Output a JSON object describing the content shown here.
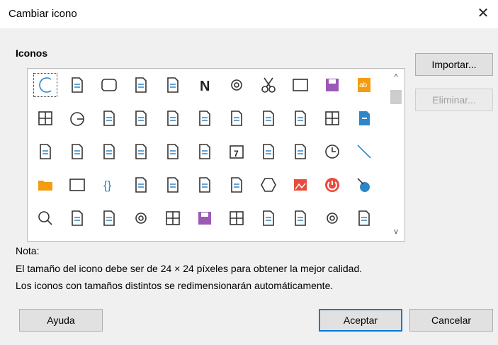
{
  "dialog": {
    "title": "Cambiar icono",
    "close_glyph": "✕"
  },
  "icons_label": "Iconos",
  "buttons": {
    "import": "Importar...",
    "delete": "Eliminar...",
    "help": "Ayuda",
    "accept": "Aceptar",
    "cancel": "Cancelar"
  },
  "note": {
    "heading": "Nota:",
    "line1": "El tamaño del icono debe ser de 24 × 24 píxeles para obtener la mejor calidad.",
    "line2": "Los iconos con tamaños distintos se redimensionarán automáticamente."
  },
  "scrollbar": {
    "up": "^",
    "down": "v"
  },
  "colors": {
    "accent": "#0078d7",
    "purple": "#9b59b6",
    "orange": "#f39c12",
    "red": "#e74c3c",
    "blue": "#2d86c7"
  },
  "icons": [
    [
      "arc-icon",
      "page-icon",
      "rounded-rect-icon",
      "field-doc-icon",
      "hash-frame-icon",
      "bold-n-icon",
      "settings-shape-icon",
      "scissors-icon",
      "square-icon",
      "save-edit-icon",
      "spellcheck-icon"
    ],
    [
      "table-grid-icon",
      "pie-icon",
      "sort-descending-icon",
      "portrait-frame-icon",
      "copy-doc-icon",
      "dots-bar-icon",
      "picture-edit-icon",
      "note-fold-icon",
      "add-list-icon",
      "spreadsheet-icon",
      "doc-blue-icon"
    ],
    [
      "text-cursor-icon",
      "pdf-icon",
      "numbered-page-icon",
      "columns-icon",
      "spell-abc-icon",
      "line-spacing-icon",
      "calendar-icon",
      "font-grow-icon",
      "two-pages-icon",
      "clock-icon",
      "diagonal-line-icon"
    ],
    [
      "folder-icon",
      "rectangle-icon",
      "braces-icon",
      "list-icon",
      "printer-icon",
      "blank-page-icon",
      "curve-icon",
      "hexagon-icon",
      "image-icon",
      "power-icon",
      "node-icon"
    ],
    [
      "zoom-icon",
      "redo-icon",
      "field-doc-icon-2",
      "frame-settings-icon",
      "layout-icon",
      "save-purple-icon",
      "grid-layout-icon",
      "page-break-icon",
      "duplicate-icon",
      "gear-icon",
      "form-icon"
    ]
  ]
}
